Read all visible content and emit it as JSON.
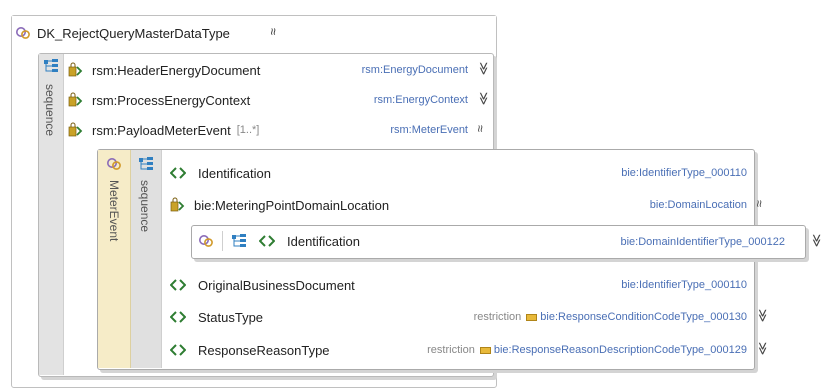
{
  "root": {
    "title": "DK_RejectQueryMasterDataType",
    "chevron": "≈"
  },
  "outer": {
    "band_label": "sequence",
    "rows": [
      {
        "name": "rsm:HeaderEnergyDocument",
        "occurs": "",
        "type": "rsm:EnergyDocument",
        "chevron": "≫"
      },
      {
        "name": "rsm:ProcessEnergyContext",
        "occurs": "",
        "type": "rsm:EnergyContext",
        "chevron": "≫"
      },
      {
        "name": "rsm:PayloadMeterEvent",
        "occurs": "[1..*]",
        "type": "rsm:MeterEvent",
        "chevron": "≈"
      }
    ]
  },
  "meter_event": {
    "band_label": "MeterEvent",
    "seq_label": "sequence",
    "rows": [
      {
        "name": "Identification",
        "type": "bie:IdentifierType_000110",
        "restriction": "",
        "chevron": ""
      },
      {
        "name": "bie:MeteringPointDomainLocation",
        "type": "bie:DomainLocation",
        "restriction": "",
        "chevron": "≈"
      },
      {
        "name": "OriginalBusinessDocument",
        "type": "bie:IdentifierType_000110",
        "restriction": "",
        "chevron": ""
      },
      {
        "name": "StatusType",
        "type": "bie:ResponseConditionCodeType_000130",
        "restriction": "restriction",
        "chevron": "≫"
      },
      {
        "name": "ResponseReasonType",
        "type": "bie:ResponseReasonDescriptionCodeType_000129",
        "restriction": "restriction",
        "chevron": "≫"
      }
    ]
  },
  "domain_location": {
    "name": "Identification",
    "type": "bie:DomainIdentifierType_000122",
    "chevron": "≫"
  },
  "colors": {
    "sequence_band": "#dcdcdc",
    "meter_band": "#f6ecc8",
    "type_text": "#4a6fb5",
    "border": "#b9b9b9"
  }
}
